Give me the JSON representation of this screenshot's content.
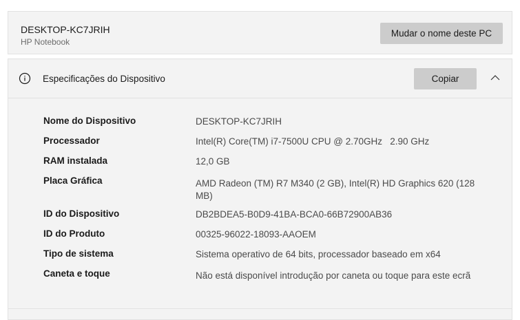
{
  "device": {
    "name": "DESKTOP-KC7JRIH",
    "model": "HP Notebook",
    "rename_label": "Mudar o nome deste PC"
  },
  "specs": {
    "title": "Especificações do Dispositivo",
    "copy_label": "Copiar",
    "rows": [
      {
        "label": "Nome do Dispositivo",
        "value": "DESKTOP-KC7JRIH"
      },
      {
        "label": "Processador",
        "value": "Intel(R) Core(TM) i7-7500U CPU @ 2.70GHz   2.90 GHz"
      },
      {
        "label": "RAM instalada",
        "value": "12,0 GB"
      },
      {
        "label": "Placa Gráfica",
        "value": "AMD Radeon (TM) R7 M340 (2 GB), Intel(R) HD Graphics 620 (128 MB)"
      },
      {
        "label": "ID do Dispositivo",
        "value": "DB2BDEA5-B0D9-41BA-BCA0-66B72900AB36"
      },
      {
        "label": "ID do Produto",
        "value": "00325-96022-18093-AAOEM"
      },
      {
        "label": "Tipo de sistema",
        "value": "Sistema operativo de 64 bits, processador baseado em x64"
      },
      {
        "label": "Caneta e toque",
        "value": "Não está disponível introdução por caneta ou toque para este ecrã"
      }
    ]
  },
  "icons": {
    "info": "info-icon",
    "collapse": "chevron-up-icon"
  }
}
